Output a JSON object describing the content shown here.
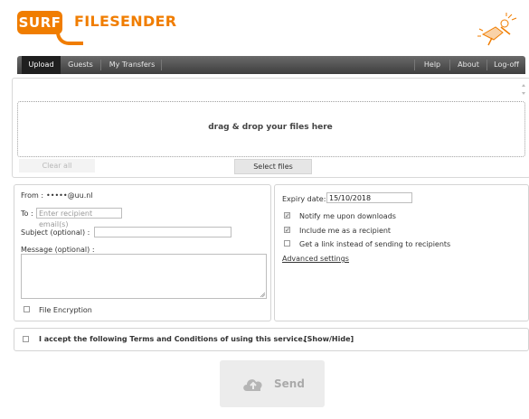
{
  "brand": {
    "logo_surf": "SURF",
    "logo_product": "FILESENDER"
  },
  "nav": {
    "items": [
      "Upload",
      "Guests",
      "My Transfers"
    ],
    "right_items": [
      "Help",
      "About",
      "Log-off"
    ],
    "active": "Upload"
  },
  "dropzone": {
    "text": "drag & drop your files here",
    "clear_all": "Clear all",
    "select_files": "Select files"
  },
  "form": {
    "from_label": "From :",
    "from_value": "•••••@uu.nl",
    "to_label": "To :",
    "to_placeholder": "Enter recipient email(s)",
    "subject_label": "Subject (optional) :",
    "subject_value": "",
    "message_label": "Message (optional) :",
    "file_encryption": "File Encryption",
    "file_encryption_checked": false
  },
  "options": {
    "expiry_label": "Expiry date:",
    "expiry_value": "15/10/2018",
    "notify_label": "Notify me upon downloads",
    "notify_checked": true,
    "include_label": "Include me as a recipient",
    "include_checked": true,
    "link_label": "Get a link instead of sending to recipients",
    "link_checked": false,
    "advanced": "Advanced settings"
  },
  "terms": {
    "text": "I accept the following Terms and Conditions of using this service.",
    "toggle": "[Show/Hide]",
    "checked": false
  },
  "send": {
    "label": "Send"
  },
  "colors": {
    "brand_orange": "#f07d00",
    "nav_dark": "#3e3e3e",
    "nav_active": "#1f1f1f"
  }
}
